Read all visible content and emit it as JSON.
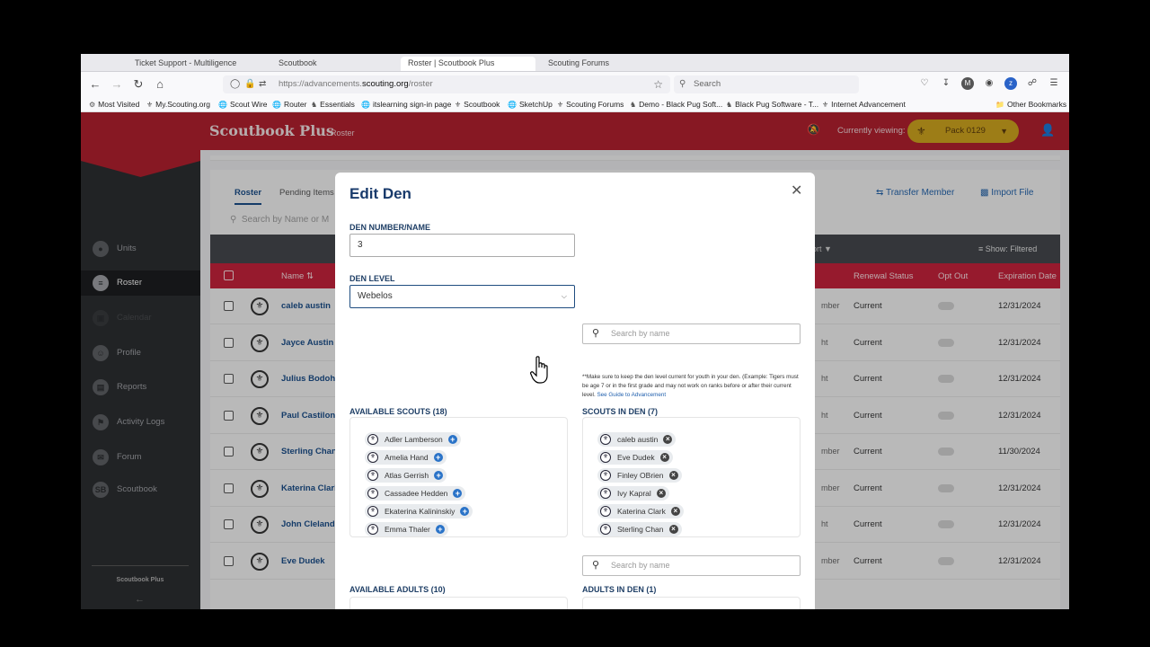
{
  "browser": {
    "tabs": [
      {
        "label": "Ticket Support - Multiligence"
      },
      {
        "label": "Scoutbook"
      },
      {
        "label": "Roster | Scoutbook Plus"
      },
      {
        "label": "Scouting Forums"
      }
    ],
    "url_prefix": "https://advancements.",
    "url_domain": "scouting.org",
    "url_path": "/roster",
    "search_placeholder": "Search",
    "bookmarks": [
      "Most Visited",
      "My.Scouting.org",
      "Scout Wire",
      "Router",
      "Essentials",
      "itslearning sign-in page",
      "Scoutbook",
      "SketchUp",
      "Scouting Forums",
      "Demo - Black Pug Soft...",
      "Black Pug Software - T...",
      "Internet Advancement"
    ],
    "other_bookmarks": "Other Bookmarks",
    "profile_initial": "M"
  },
  "app": {
    "logo": "Scoutbook Plus",
    "breadcrumb": "Roster",
    "currently_viewing": "Currently viewing:",
    "unit": "Pack 0129",
    "colors": {
      "header": "#ad1f2e",
      "accent": "#c9a11e",
      "link": "#1a4c86"
    }
  },
  "sidebar": {
    "items": [
      {
        "label": "Units",
        "icon": "map-pin-icon"
      },
      {
        "label": "Roster",
        "icon": "list-icon"
      },
      {
        "label": "Calendar",
        "icon": "calendar-icon"
      },
      {
        "label": "Profile",
        "icon": "profile-icon"
      },
      {
        "label": "Reports",
        "icon": "report-icon"
      },
      {
        "label": "Activity Logs",
        "icon": "activity-icon"
      },
      {
        "label": "Forum",
        "icon": "forum-icon"
      },
      {
        "label": "Scoutbook",
        "icon": "scoutbook-icon"
      }
    ],
    "footer": "Scoutbook Plus"
  },
  "roster": {
    "tabs": [
      "Roster",
      "Pending Items"
    ],
    "actions": [
      "Transfer Member",
      "Import File"
    ],
    "search_placeholder": "Search by Name or M",
    "export_label": "port",
    "show_filter": "Show: Filtered",
    "columns": {
      "name": "Name",
      "renewal": "Renewal Status",
      "opt_out": "Opt Out",
      "expiration": "Expiration Date"
    },
    "rows": [
      {
        "name": "caleb austin",
        "pos": "mber",
        "status": "Current",
        "date": "12/31/2024"
      },
      {
        "name": "Jayce Austin",
        "pos": "ht",
        "status": "Current",
        "date": "12/31/2024"
      },
      {
        "name": "Julius Bodoh",
        "pos": "ht",
        "status": "Current",
        "date": "12/31/2024"
      },
      {
        "name": "Paul Castilon",
        "pos": "ht",
        "status": "Current",
        "date": "12/31/2024"
      },
      {
        "name": "Sterling Chan",
        "pos": "mber",
        "status": "Current",
        "date": "11/30/2024"
      },
      {
        "name": "Katerina Clark",
        "pos": "mber",
        "status": "Current",
        "date": "12/31/2024"
      },
      {
        "name": "John Cleland",
        "pos": "ht",
        "status": "Current",
        "date": "12/31/2024"
      },
      {
        "name": "Eve Dudek",
        "pos": "mber",
        "status": "Current",
        "date": "12/31/2024"
      }
    ]
  },
  "modal": {
    "title": "Edit Den",
    "den_number_label": "DEN NUMBER/NAME",
    "den_number_value": "3",
    "den_level_label": "DEN LEVEL",
    "den_level_value": "Webelos",
    "search_placeholder": "Search by name",
    "note": "**Make sure to keep the den level current for youth in your den. (Example: Tigers must be age 7 or in the first grade and may not work on ranks before or after their current level. ",
    "note_link": "See Guide to Advancement",
    "available_scouts_label": "AVAILABLE SCOUTS (18)",
    "scouts_in_den_label": "SCOUTS IN DEN (7)",
    "available_scouts": [
      "Adler Lamberson",
      "Amelia Hand",
      "Atlas Gerrish",
      "Cassadee Hedden",
      "Ekaterina Kalininskiy",
      "Emma Thaler"
    ],
    "scouts_in_den": [
      "caleb austin",
      "Eve Dudek",
      "Finley OBrien",
      "Ivy Kapral",
      "Katerina Clark",
      "Sterling Chan"
    ],
    "available_adults_label": "AVAILABLE ADULTS (10)",
    "adults_in_den_label": "ADULTS IN DEN (1)"
  }
}
